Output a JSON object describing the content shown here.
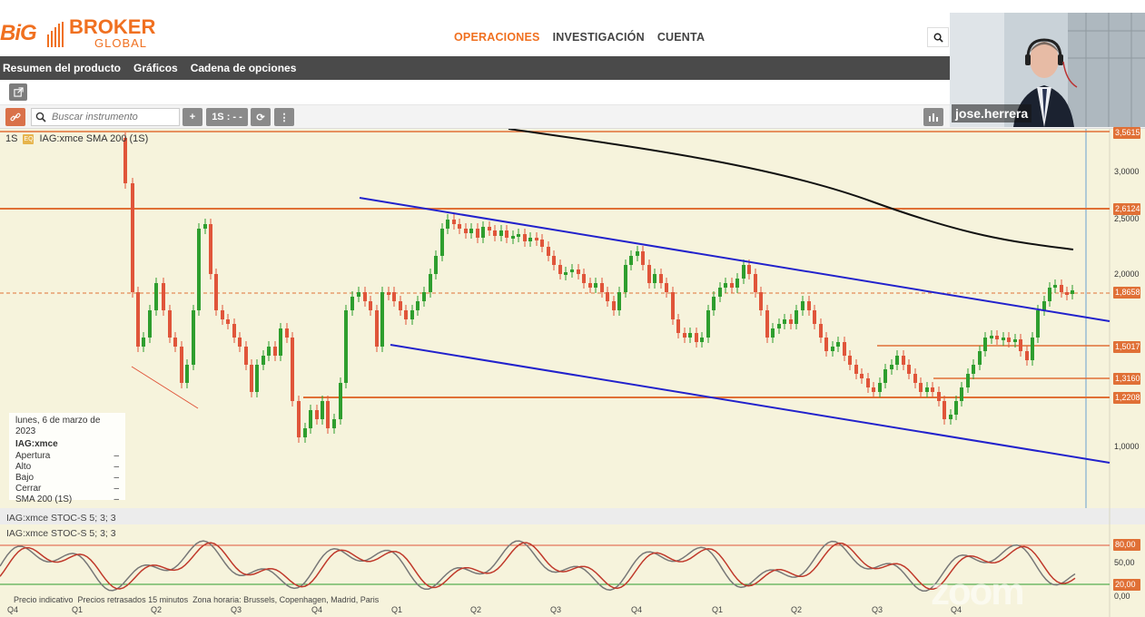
{
  "brand": {
    "big": "BiG",
    "broker": "BROKER",
    "global": "GLOBAL"
  },
  "nav": {
    "items": [
      {
        "label": "OPERACIONES",
        "active": true
      },
      {
        "label": "INVESTIGACIÓN",
        "active": false
      },
      {
        "label": "CUENTA",
        "active": false
      }
    ]
  },
  "subnav": {
    "items": [
      "Resumen del producto",
      "Gráficos",
      "Cadena de opciones"
    ],
    "selected": "Gráficos"
  },
  "toolbar": {
    "search_placeholder": "Buscar instrumento",
    "add_label": "+",
    "period_label": "1S : - -",
    "refresh_label": "⟳",
    "more_label": "⋮"
  },
  "chart_header": {
    "period": "1S",
    "symbol_line": "IAG:xmce  SMA 200 (1S)"
  },
  "price_labels": [
    {
      "value": "3,5615"
    },
    {
      "value": "2,6124"
    },
    {
      "value": "1,8658"
    },
    {
      "value": "1,5017"
    },
    {
      "value": "1,3160"
    },
    {
      "value": "1,2208"
    }
  ],
  "price_axis": [
    "3,0000",
    "2,5000",
    "2,0000",
    "1,0000"
  ],
  "info_box": {
    "date": "lunes, 6 de marzo de 2023",
    "symbol": "IAG:xmce",
    "rows": [
      {
        "label": "Apertura",
        "value": "–"
      },
      {
        "label": "Alto",
        "value": "–"
      },
      {
        "label": "Bajo",
        "value": "–"
      },
      {
        "label": "Cerrar",
        "value": "–"
      },
      {
        "label": "SMA 200 (1S)",
        "value": "–"
      }
    ]
  },
  "stoch": {
    "header1": "IAG:xmce  STOC-S 5; 3; 3",
    "header2": "IAG:xmce  STOC-S 5; 3; 3",
    "axis": [
      "80,00",
      "50,00",
      "20,00",
      "0,00"
    ]
  },
  "footer": {
    "items": [
      "Precio indicativo",
      "Precios retrasados 15 minutos",
      "Zona horaria: Brussels, Copenhagen, Madrid, Paris"
    ]
  },
  "xaxis": [
    "Q4",
    "Q1",
    "Q2",
    "Q3",
    "Q4",
    "Q1",
    "Q2",
    "Q3",
    "Q4",
    "Q1",
    "Q2",
    "Q3",
    "Q4"
  ],
  "video": {
    "name": "jose.herrera"
  },
  "watermark": "zoom",
  "colors": {
    "accent": "#f07020",
    "bull": "#2e9e2e",
    "bear": "#e0553a",
    "channel": "#2222cc",
    "level": "#e07036"
  }
}
